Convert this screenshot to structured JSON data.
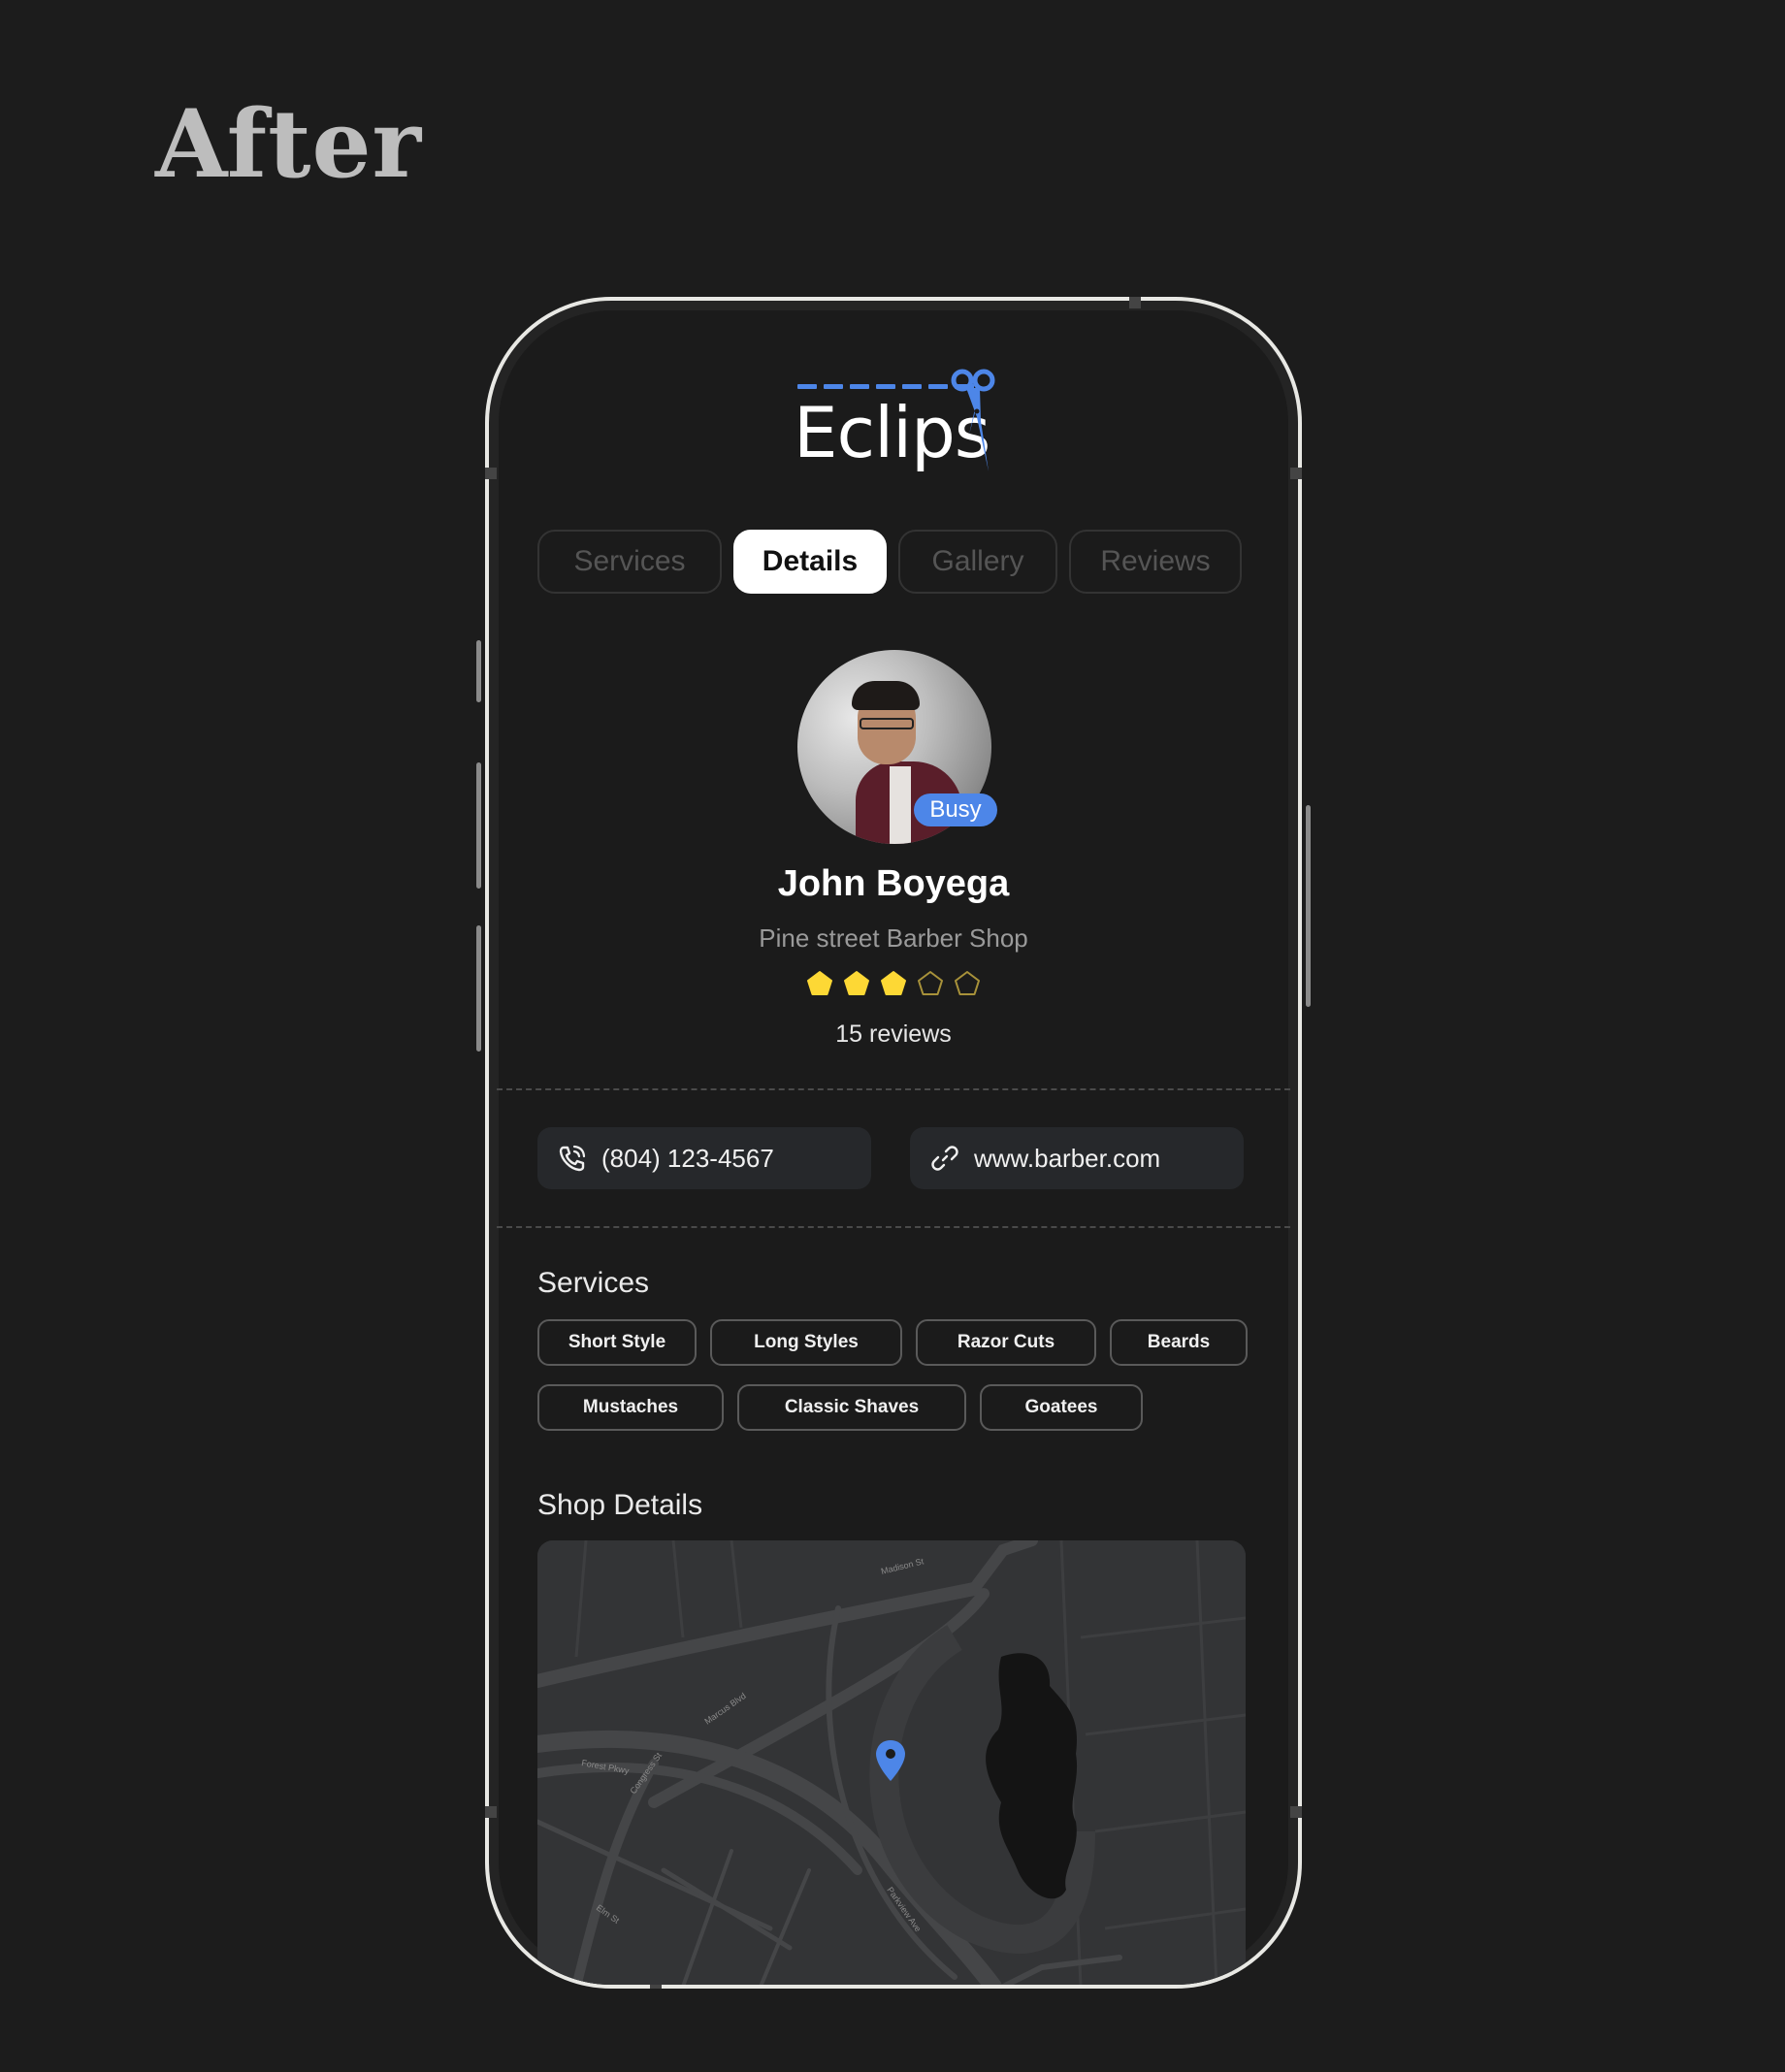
{
  "heading": "After",
  "app": {
    "logo_text": "Eclips",
    "brand_color": "#4d86e8"
  },
  "tabs": [
    {
      "label": "Services",
      "active": false
    },
    {
      "label": "Details",
      "active": true
    },
    {
      "label": "Gallery",
      "active": false
    },
    {
      "label": "Reviews",
      "active": false
    }
  ],
  "profile": {
    "status_badge": "Busy",
    "name": "John Boyega",
    "shop": "Pine street Barber Shop",
    "rating": 3,
    "rating_max": 5,
    "reviews": "15 reviews",
    "star_color": "#fdd835"
  },
  "contact": {
    "phone": "(804) 123-4567",
    "website": "www.barber.com"
  },
  "services": {
    "title": "Services",
    "items": [
      "Short Style",
      "Long Styles",
      "Razor Cuts",
      "Beards",
      "Mustaches",
      "Classic Shaves",
      "Goatees"
    ]
  },
  "shop_details": {
    "title": "Shop Details",
    "map_labels": [
      "Madison St",
      "Marcus Blvd",
      "Forest Pkwy",
      "Congress St",
      "Elm St",
      "Parkview Ave"
    ]
  }
}
